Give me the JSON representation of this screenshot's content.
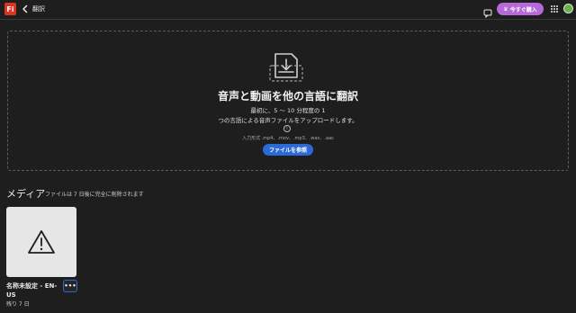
{
  "header": {
    "app_logo_text": "Fi",
    "title": "翻訳",
    "buy_label": "今すぐ購入",
    "icons": [
      "app-logo",
      "back-chevron-icon",
      "chat-icon",
      "crown-icon",
      "apps-grid-icon",
      "avatar"
    ]
  },
  "upload": {
    "title": "音声と動画を他の言語に翻訳",
    "desc_line1": "最初に、5 ～ 10 分程度の 1",
    "desc_line2": "つの言語による音声ファイルをアップロードします。",
    "info_glyph": "i",
    "formats": "入力形式 .mp4、.mov、.mp3、.wav、.aac",
    "browse_label": "ファイルを参照"
  },
  "media": {
    "heading": "メディア",
    "note": "ファイルは 7 日後に完全に削除されます",
    "items": [
      {
        "name": "名称未設定 - EN-US",
        "remaining": "残り 7 日",
        "more_label": "•••"
      }
    ]
  },
  "colors": {
    "background": "#1e1e1e",
    "buy_button": "#b769d9",
    "browse_button": "#2c6ad6",
    "logo": "#e0331f"
  }
}
